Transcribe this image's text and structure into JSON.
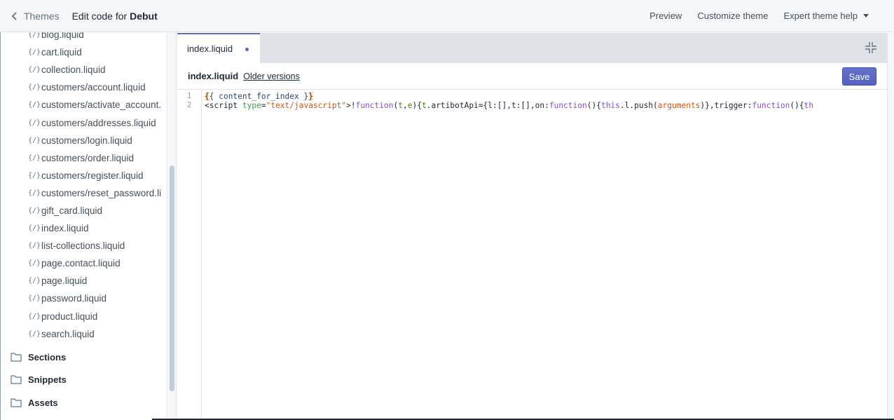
{
  "topbar": {
    "back_label": "Themes",
    "title_prefix": "Edit code for",
    "title_theme": "Debut",
    "actions": {
      "preview": "Preview",
      "customize": "Customize theme",
      "expert_help": "Expert theme help"
    }
  },
  "sidebar": {
    "file_icon_glyph": "{/}",
    "files": [
      "blog.liquid",
      "cart.liquid",
      "collection.liquid",
      "customers/account.liquid",
      "customers/activate_account.",
      "customers/addresses.liquid",
      "customers/login.liquid",
      "customers/order.liquid",
      "customers/register.liquid",
      "customers/reset_password.li",
      "gift_card.liquid",
      "index.liquid",
      "list-collections.liquid",
      "page.contact.liquid",
      "page.liquid",
      "password.liquid",
      "product.liquid",
      "search.liquid"
    ],
    "folders": {
      "sections": "Sections",
      "snippets": "Snippets",
      "assets": "Assets"
    }
  },
  "tabs": [
    {
      "label": "index.liquid",
      "unsaved": true
    }
  ],
  "editor": {
    "file_name": "index.liquid",
    "older_versions": "Older versions",
    "save_label": "Save",
    "line_numbers": [
      "1",
      "2"
    ],
    "line1": {
      "open_brace": "{",
      "content": "{ content_for_index }",
      "close_brace": "}"
    },
    "line2": {
      "tag_open": "<script ",
      "attr_name": "type",
      "eq": "=",
      "attr_value": "\"text/javascript\"",
      "after_tag": ">!",
      "kw_function": "function",
      "p1": "(",
      "arg_t": "t",
      "comma": ",",
      "arg_e": "e",
      "p2": "){",
      "t2": "t",
      "api": ".artibotApi={l:[],t:[],on:",
      "kw_function2": "function",
      "p3": "(){",
      "kw_this": "this",
      "push": ".l.push(",
      "arguments": "arguments",
      "after_args": ")},trigger:",
      "kw_function3": "function",
      "p4": "(){",
      "kw_this2": "th"
    }
  },
  "colors": {
    "accent": "#5c6ac4",
    "topbar_bg": "#f4f6f8",
    "border": "#dfe3e8"
  },
  "icons": {
    "back": "chevron-left-icon",
    "dropdown": "caret-down-icon",
    "folder": "folder-icon",
    "collapse": "collapse-icon",
    "file": "liquid-file-icon"
  }
}
